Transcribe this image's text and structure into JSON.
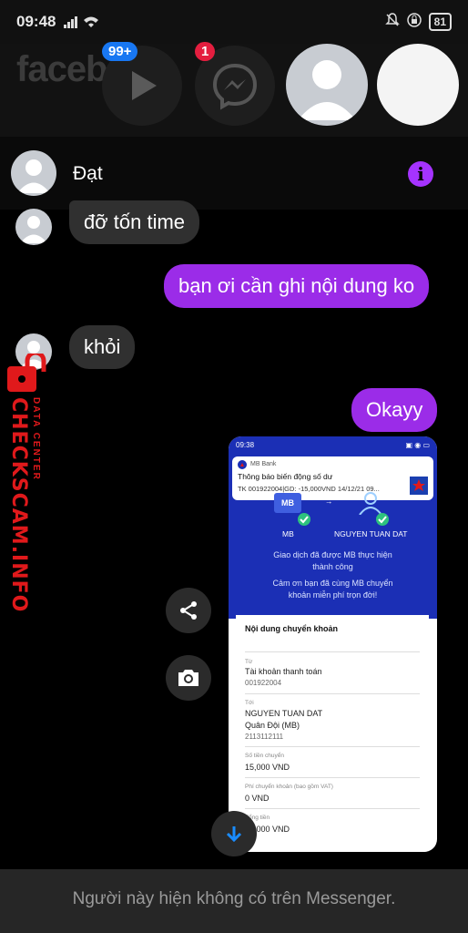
{
  "status_bar": {
    "time": "09:48",
    "battery": "81"
  },
  "facebook_bg": {
    "logo": "faceb",
    "watch_badge": "99+",
    "messenger_badge": "1"
  },
  "chat": {
    "contact_name": "Đạt",
    "messages": [
      {
        "direction": "in",
        "text": "đỡ tốn time"
      },
      {
        "direction": "out",
        "text": "bạn ơi cần ghi nội dung ko"
      },
      {
        "direction": "in",
        "text": "khỏi"
      },
      {
        "direction": "out",
        "text": "Okayy"
      }
    ],
    "footer_notice": "Người này hiện không có trên Messenger."
  },
  "screenshot": {
    "status_time": "09:38",
    "notification": {
      "app": "MB Bank",
      "title": "Thông báo biến động số dư",
      "body": "TK 001922004|GD: -15,000VND 14/12/21 09..."
    },
    "from_label": "MB",
    "to_label": "NGUYEN TUAN DAT",
    "success_text_1": "Giao dịch đã được MB thực hiện",
    "success_text_2": "thành công",
    "thanks_text_1": "Cảm ơn bạn đã cùng MB chuyển",
    "thanks_text_2": "khoản miễn phí trọn đời!",
    "card_title": "Nội dung chuyển khoản",
    "from_key": "Từ",
    "from_account_type": "Tài khoản thanh toán",
    "from_account": "001922004",
    "to_key": "Tới",
    "to_name": "NGUYEN TUAN DAT",
    "to_bank": "Quân Đội (MB)",
    "to_account": "2113112111",
    "amount_key": "Số tiền chuyển",
    "amount": "15,000 VND",
    "fee_key": "Phí chuyển khoản (bao gồm VAT)",
    "fee": "0 VND",
    "total_key": "Tổng tiền",
    "total": "15,000 VND"
  },
  "watermark": {
    "brand": "CHECKSCAM.INFO",
    "sub": "DATA CENTER"
  },
  "colors": {
    "outgoing_bubble": "#9b2ce8",
    "incoming_bubble": "#303030",
    "info_icon": "#a533ff",
    "badge_blue": "#1877f2",
    "badge_red": "#e41e3f",
    "watermark_red": "#e0191b"
  }
}
